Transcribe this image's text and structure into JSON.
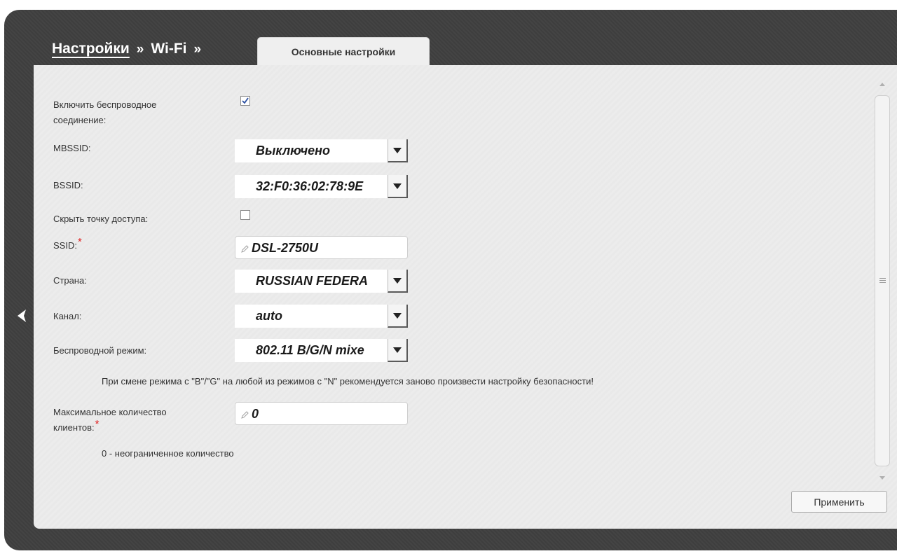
{
  "breadcrumb": {
    "settings": "Настройки",
    "sep1": "»",
    "wifi": "Wi-Fi",
    "sep2": "»",
    "current_tab": "Основные настройки"
  },
  "icons": {
    "back": "chevron-left-icon",
    "edit": "pencil-icon",
    "dropdown": "triangle-down-icon",
    "check": "checkmark-icon",
    "scroll_up": "scroll-up-icon",
    "scroll_down": "scroll-down-icon",
    "scroll_grip": "grip-lines-icon"
  },
  "colors": {
    "frame": "#3f3f3f",
    "panel": "#ececec",
    "required": "#e02020"
  },
  "form": {
    "enable_wireless": {
      "label_line1": "Включить беспроводное",
      "label_line2": "соединение:",
      "checked": true
    },
    "mbssid": {
      "label": "MBSSID:",
      "value": "Выключено"
    },
    "bssid": {
      "label": "BSSID:",
      "value": "32:F0:36:02:78:9E"
    },
    "hide_ap": {
      "label": "Скрыть точку доступа:",
      "checked": false
    },
    "ssid": {
      "label": "SSID:",
      "required_mark": "*",
      "value": "DSL-2750U"
    },
    "country": {
      "label": "Страна:",
      "value": "RUSSIAN FEDERA"
    },
    "channel": {
      "label": "Канал:",
      "value": "auto"
    },
    "wireless_mode": {
      "label": "Беспроводной режим:",
      "value": "802.11 B/G/N mixe"
    },
    "mode_warning": "При смене режима с \"B\"/\"G\" на любой из режимов с \"N\" рекомендуется заново произвести настройку безопасности!",
    "max_clients": {
      "label_line1": "Максимальное количество",
      "label_line2": "клиентов:",
      "required_mark": "*",
      "value": "0"
    },
    "max_clients_hint": "0 - неограниченное количество"
  },
  "buttons": {
    "apply": "Применить"
  }
}
